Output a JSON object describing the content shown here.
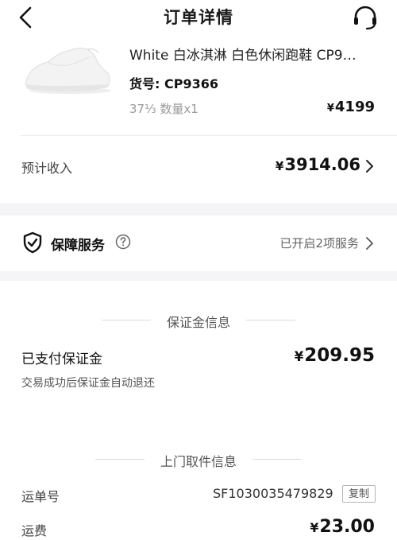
{
  "header": {
    "title": "订单详情",
    "back_icon": "chevron-left-icon",
    "service_icon": "headset-icon"
  },
  "product": {
    "name": "White 白冰淇淋 白色休闲跑鞋 CP9…",
    "sku": "货号: CP9366",
    "size_qty": "37⅓ 数量x1",
    "price_symbol": "¥",
    "price": "4199"
  },
  "income": {
    "label": "预计收入",
    "symbol": "¥",
    "value": "3914.06"
  },
  "guarantee": {
    "label": "保障服务",
    "status": "已开启2项服务",
    "icon": "shield-check-icon"
  },
  "deposit_section": {
    "title": "保证金信息",
    "paid_label": "已支付保证金",
    "symbol": "¥",
    "paid_value": "209.95",
    "note": "交易成功后保证金自动退还"
  },
  "pickup_section": {
    "title": "上门取件信息",
    "waybill_label": "运单号",
    "waybill_value": "SF1030035479829",
    "copy_label": "复制",
    "fee_label": "运费",
    "symbol": "¥",
    "fee_value": "23.00"
  }
}
